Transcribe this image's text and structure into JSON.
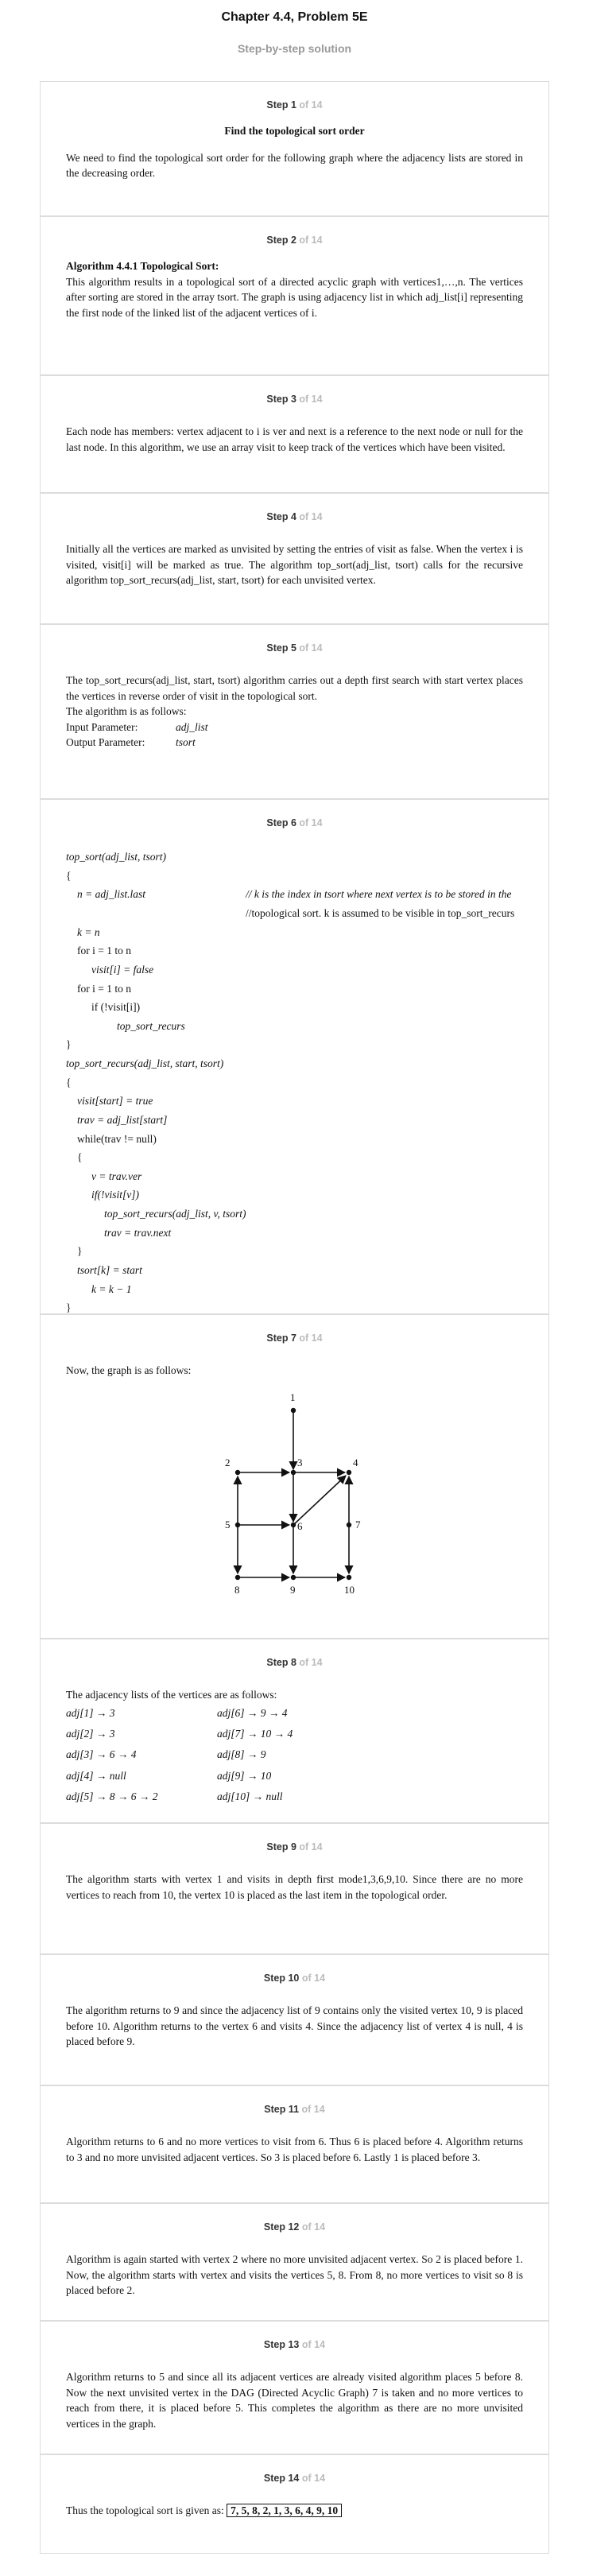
{
  "header": {
    "title": "Chapter 4.4, Problem 5E",
    "subtitle": "Step-by-step solution"
  },
  "total": "of 14",
  "steps": [
    {
      "label": "Step 1",
      "heading": "Find the topological sort order",
      "text": "We need to find the topological sort order for the following graph where the adjacency lists are stored in the decreasing order."
    },
    {
      "label": "Step 2",
      "heading": "Algorithm 4.4.1 Topological Sort:",
      "text": "This algorithm results in a topological sort of a directed acyclic graph with vertices1,…,n. The vertices after sorting are stored in the array tsort. The graph is using adjacency list in which adj_list[i] representing the first node of the linked list of the adjacent vertices of i."
    },
    {
      "label": "Step 3",
      "text": "Each node has members: vertex adjacent to i is ver and next is a reference to the next node or null for the last node. In this algorithm, we use an array visit to keep track of the vertices which have been visited."
    },
    {
      "label": "Step 4",
      "text": "Initially all the vertices are marked as unvisited by setting the entries of visit as false. When the vertex i is visited, visit[i] will be marked as true. The algorithm top_sort(adj_list, tsort) calls for the recursive algorithm top_sort_recurs(adj_list, start, tsort) for each unvisited vertex."
    },
    {
      "label": "Step 5",
      "text": "The top_sort_recurs(adj_list, start, tsort) algorithm carries out a depth first search with start vertex places the vertices in reverse order of visit in the topological sort.",
      "text2": "The algorithm is as follows:",
      "in_label": "Input Parameter:",
      "in_value": "adj_list",
      "out_label": "Output Parameter:",
      "out_value": "tsort"
    },
    {
      "label": "Step 6",
      "code": [
        "top_sort(adj_list, tsort)",
        "{",
        "n = adj_list.last",
        "// k is the index in tsort where next vertex is to be stored in the",
        "//topological sort. k is assumed to be visible in top_sort_recurs",
        "k = n",
        "for i = 1 to n",
        "visit[i] = false",
        "for i = 1 to n",
        "if (!visit[i])",
        "top_sort_recurs",
        "}",
        "top_sort_recurs(adj_list, start, tsort)",
        "{",
        "visit[start] = true",
        "trav = adj_list[start]",
        "while(trav != null)",
        "{",
        "v = trav.ver",
        "if(!visit[v])",
        "top_sort_recurs(adj_list, v, tsort)",
        "trav = trav.next",
        "}",
        "tsort[k] = start",
        "k = k − 1",
        "}"
      ]
    },
    {
      "label": "Step 7",
      "text": "Now, the graph is as follows:",
      "graph_nodes": [
        "1",
        "2",
        "3",
        "4",
        "5",
        "6",
        "7",
        "8",
        "9",
        "10"
      ]
    },
    {
      "label": "Step 8",
      "text": "The adjacency lists of the vertices are as follows:",
      "adj_left": [
        "adj[1] → 3",
        "adj[2] → 3",
        "adj[3] → 6 → 4",
        "adj[4] → null",
        "adj[5] → 8 → 6 → 2"
      ],
      "adj_right": [
        "adj[6] → 9 → 4",
        "adj[7] → 10 → 4",
        "adj[8] → 9",
        "adj[9] → 10",
        "adj[10] → null"
      ]
    },
    {
      "label": "Step 9",
      "text": "The algorithm starts with vertex 1 and visits in depth first mode1,3,6,9,10. Since there are no more vertices to reach from 10, the vertex 10 is placed as the last item in the topological order."
    },
    {
      "label": "Step 10",
      "text": "The algorithm returns to 9 and since the adjacency list of 9 contains only the visited vertex 10, 9 is placed before 10. Algorithm returns to the vertex 6 and visits 4. Since the adjacency list of vertex 4 is null, 4 is placed before 9."
    },
    {
      "label": "Step 11",
      "text": "Algorithm returns to 6 and no more vertices to visit from 6. Thus 6 is placed before 4. Algorithm returns to 3 and no more unvisited adjacent vertices. So 3 is placed before 6. Lastly 1 is placed before 3."
    },
    {
      "label": "Step 12",
      "text": "Algorithm is again started with vertex 2 where no more unvisited adjacent vertex. So 2 is placed before 1. Now, the algorithm starts with vertex and visits the vertices 5, 8. From 8, no more vertices to visit so 8 is placed before 2."
    },
    {
      "label": "Step 13",
      "text": "Algorithm returns to 5 and since all its adjacent vertices are already visited algorithm places 5 before 8. Now the next unvisited vertex in the DAG (Directed Acyclic Graph) 7 is taken and no more vertices to reach from there, it is placed before 5. This completes the algorithm as there are no more unvisited vertices in the graph."
    },
    {
      "label": "Step 14",
      "text": "Thus the topological sort is given as:",
      "answer": "7, 5, 8, 2, 1, 3, 6, 4, 9, 10"
    }
  ]
}
